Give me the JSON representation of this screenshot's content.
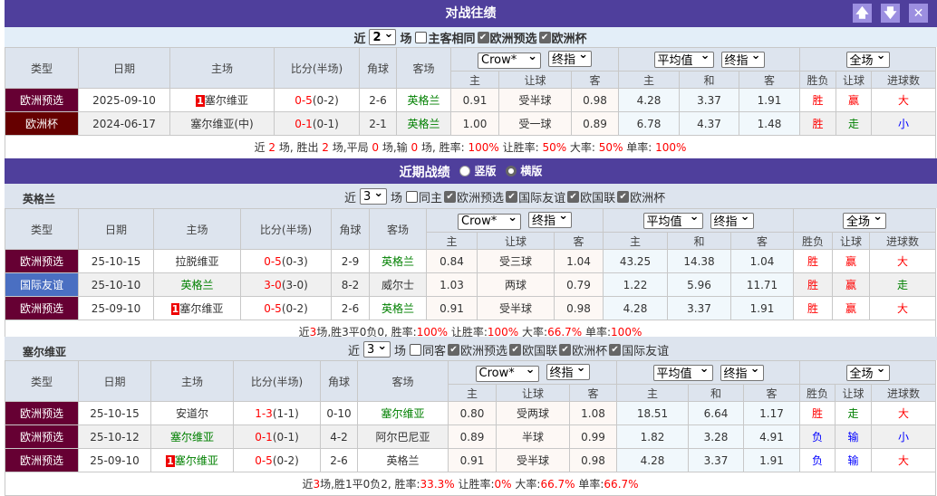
{
  "colors": {
    "header_bar": "#4f3f9c",
    "euro_qual": "#660033",
    "euro_cup": "#660000",
    "friendly": "#4a6fc2",
    "win": "#ff0000",
    "draw": "#008000",
    "loss": "#0000ff"
  },
  "h2h": {
    "title": "对战往绩",
    "buttons": [
      {
        "icon": "arrow-up-icon",
        "glyph": "🡅"
      },
      {
        "icon": "arrow-down-icon",
        "glyph": "🡇"
      },
      {
        "icon": "close-icon",
        "glyph": "✕"
      }
    ],
    "filter": {
      "prefix": "近",
      "count": "2",
      "suffix": "场",
      "same_label": "主客相同",
      "same_checked": false,
      "checks": [
        {
          "label": "欧洲预选",
          "checked": true
        },
        {
          "label": "欧洲杯",
          "checked": true
        }
      ]
    },
    "selects": {
      "company": "Crow*",
      "odds_type": "终指",
      "eu_company": "平均值",
      "eu_type": "终指",
      "period": "全场"
    },
    "headers": [
      "类型",
      "日期",
      "主场",
      "比分(半场)",
      "角球",
      "客场"
    ],
    "sub_headers": [
      "主",
      "让球",
      "客",
      "主",
      "和",
      "客",
      "胜负",
      "让球",
      "进球数"
    ],
    "rows": [
      {
        "type": "欧洲预选",
        "type_color": "#660033",
        "date": "2025-09-10",
        "home_rank": "1",
        "home": "塞尔维亚",
        "home_green": false,
        "score_ft": "0-5",
        "score_ht": "(0-2)",
        "corners": "2-6",
        "away": "英格兰",
        "away_green": true,
        "ah": [
          "0.91",
          "受半球",
          "0.98"
        ],
        "eu": [
          "4.28",
          "3.37",
          "1.91"
        ],
        "wl": "胜",
        "ahr": "赢",
        "ou": "大"
      },
      {
        "type": "欧洲杯",
        "type_color": "#660000",
        "date": "2024-06-17",
        "home_rank": "",
        "home": "塞尔维亚(中)",
        "home_green": false,
        "score_ft": "0-1",
        "score_ht": "(0-1)",
        "corners": "2-1",
        "away": "英格兰",
        "away_green": true,
        "ah": [
          "1.00",
          "受一球",
          "0.89"
        ],
        "eu": [
          "6.78",
          "4.37",
          "1.48"
        ],
        "wl": "胜",
        "ahr": "走",
        "ou": "小"
      }
    ],
    "summary": [
      {
        "t": "近 "
      },
      {
        "t": "2",
        "r": 1
      },
      {
        "t": " 场, 胜出 "
      },
      {
        "t": "2",
        "r": 1
      },
      {
        "t": " 场,平局 "
      },
      {
        "t": "0",
        "r": 1
      },
      {
        "t": " 场,输 "
      },
      {
        "t": "0",
        "r": 1
      },
      {
        "t": " 场, 胜率: "
      },
      {
        "t": "100%",
        "r": 1
      },
      {
        "t": " 让胜率: "
      },
      {
        "t": "50%",
        "r": 1
      },
      {
        "t": " 大率: "
      },
      {
        "t": "50%",
        "r": 1
      },
      {
        "t": " 单率: "
      },
      {
        "t": "100%",
        "r": 1
      }
    ]
  },
  "recent": {
    "title": "近期战绩",
    "layout_options": [
      {
        "label": "竖版",
        "selected": false
      },
      {
        "label": "横版",
        "selected": true
      }
    ],
    "teams": [
      {
        "name": "英格兰",
        "filter": {
          "prefix": "近",
          "count": "3",
          "suffix": "场",
          "same_label": "同主",
          "same_checked": false,
          "checks": [
            {
              "label": "欧洲预选",
              "checked": true
            },
            {
              "label": "国际友谊",
              "checked": true
            },
            {
              "label": "欧国联",
              "checked": true
            },
            {
              "label": "欧洲杯",
              "checked": true
            }
          ]
        },
        "rows": [
          {
            "type": "欧洲预选",
            "type_color": "#660033",
            "date": "25-10-15",
            "home_rank": "",
            "home": "拉脱维亚",
            "home_green": false,
            "score_ft": "0-5",
            "score_ht": "(0-3)",
            "corners": "2-9",
            "away": "英格兰",
            "away_green": true,
            "ah": [
              "0.84",
              "受三球",
              "1.04"
            ],
            "eu": [
              "43.25",
              "14.38",
              "1.04"
            ],
            "wl": "胜",
            "ahr": "赢",
            "ou": "大"
          },
          {
            "type": "国际友谊",
            "type_color": "#4a6fc2",
            "date": "25-10-10",
            "home_rank": "",
            "home": "英格兰",
            "home_green": true,
            "score_ft": "3-0",
            "score_ht": "(3-0)",
            "corners": "8-2",
            "away": "威尔士",
            "away_green": false,
            "ah": [
              "1.03",
              "两球",
              "0.79"
            ],
            "eu": [
              "1.22",
              "5.96",
              "11.71"
            ],
            "wl": "胜",
            "ahr": "赢",
            "ou": "走"
          },
          {
            "type": "欧洲预选",
            "type_color": "#660033",
            "date": "25-09-10",
            "home_rank": "1",
            "home": "塞尔维亚",
            "home_green": false,
            "score_ft": "0-5",
            "score_ht": "(0-2)",
            "corners": "2-6",
            "away": "英格兰",
            "away_green": true,
            "ah": [
              "0.91",
              "受半球",
              "0.98"
            ],
            "eu": [
              "4.28",
              "3.37",
              "1.91"
            ],
            "wl": "胜",
            "ahr": "赢",
            "ou": "大"
          }
        ],
        "summary": [
          {
            "t": "近"
          },
          {
            "t": "3",
            "r": 1
          },
          {
            "t": "场,胜3平0负0, 胜率:"
          },
          {
            "t": "100%",
            "r": 1
          },
          {
            "t": " 让胜率:"
          },
          {
            "t": "100%",
            "r": 1
          },
          {
            "t": " 大率:"
          },
          {
            "t": "66.7%",
            "r": 1
          },
          {
            "t": " 单率:"
          },
          {
            "t": "100%",
            "r": 1
          }
        ]
      },
      {
        "name": "塞尔维亚",
        "filter": {
          "prefix": "近",
          "count": "3",
          "suffix": "场",
          "same_label": "同客",
          "same_checked": false,
          "checks": [
            {
              "label": "欧洲预选",
              "checked": true
            },
            {
              "label": "欧国联",
              "checked": true
            },
            {
              "label": "欧洲杯",
              "checked": true
            },
            {
              "label": "国际友谊",
              "checked": true
            }
          ]
        },
        "rows": [
          {
            "type": "欧洲预选",
            "type_color": "#660033",
            "date": "25-10-15",
            "home_rank": "",
            "home": "安道尔",
            "home_green": false,
            "score_ft": "1-3",
            "score_ht": "(1-1)",
            "corners": "0-10",
            "away": "塞尔维亚",
            "away_green": true,
            "ah": [
              "0.80",
              "受两球",
              "1.08"
            ],
            "eu": [
              "18.51",
              "6.64",
              "1.17"
            ],
            "wl": "胜",
            "ahr": "走",
            "ou": "大"
          },
          {
            "type": "欧洲预选",
            "type_color": "#660033",
            "date": "25-10-12",
            "home_rank": "",
            "home": "塞尔维亚",
            "home_green": true,
            "score_ft": "0-1",
            "score_ht": "(0-1)",
            "corners": "4-2",
            "away": "阿尔巴尼亚",
            "away_green": false,
            "ah": [
              "0.89",
              "半球",
              "0.99"
            ],
            "eu": [
              "1.82",
              "3.28",
              "4.91"
            ],
            "wl": "负",
            "ahr": "输",
            "ou": "小"
          },
          {
            "type": "欧洲预选",
            "type_color": "#660033",
            "date": "25-09-10",
            "home_rank": "1",
            "home": "塞尔维亚",
            "home_green": true,
            "score_ft": "0-5",
            "score_ht": "(0-2)",
            "corners": "2-6",
            "away": "英格兰",
            "away_green": false,
            "ah": [
              "0.91",
              "受半球",
              "0.98"
            ],
            "eu": [
              "4.28",
              "3.37",
              "1.91"
            ],
            "wl": "负",
            "ahr": "输",
            "ou": "大"
          }
        ],
        "summary": [
          {
            "t": "近"
          },
          {
            "t": "3",
            "r": 1
          },
          {
            "t": "场,胜1平0负2, 胜率:"
          },
          {
            "t": "33.3%",
            "r": 1
          },
          {
            "t": " 让胜率:"
          },
          {
            "t": "0%",
            "r": 1
          },
          {
            "t": " 大率:"
          },
          {
            "t": "66.7%",
            "r": 1
          },
          {
            "t": " 单率:"
          },
          {
            "t": "66.7%",
            "r": 1
          }
        ]
      }
    ]
  }
}
